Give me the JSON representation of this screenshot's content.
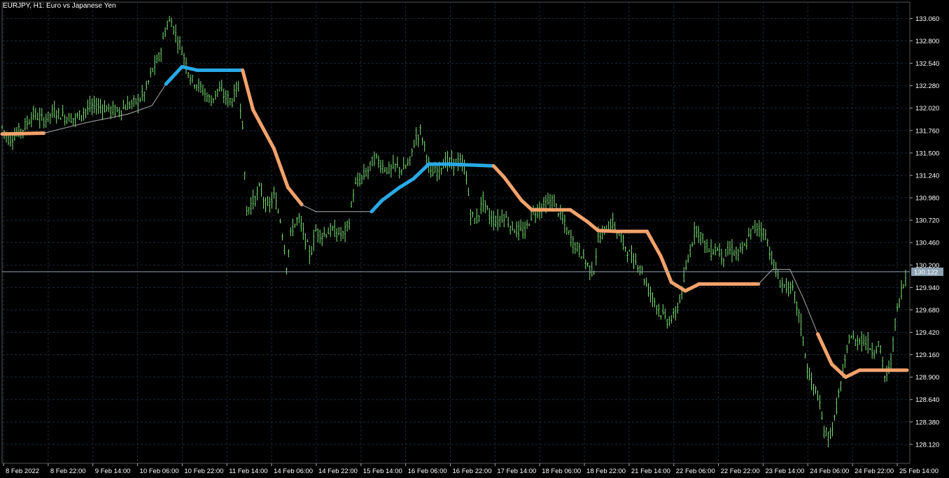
{
  "window": {
    "title": "EURJPY, H1:  Euro vs Japanese Yen"
  },
  "price_label": "130.122",
  "colors": {
    "background": "#000000",
    "grid": "#1a2a3a",
    "candle": "#7fe57a",
    "bull_line": "#29a9e6",
    "bear_line": "#f4a26b",
    "neutral_line": "#8f8f8f",
    "price_line": "#8da2b3",
    "axis": "#ffffff"
  },
  "chart_data": {
    "type": "line",
    "title": "EURJPY, H1:  Euro vs Japanese Yen",
    "xlabel": "",
    "ylabel": "",
    "ylim": [
      127.9,
      133.25
    ],
    "x_ticks": [
      "8 Feb 2022",
      "8 Feb 22:00",
      "9 Feb 14:00",
      "10 Feb 06:00",
      "10 Feb 22:00",
      "11 Feb 14:00",
      "14 Feb 06:00",
      "14 Feb 22:00",
      "15 Feb 14:00",
      "16 Feb 06:00",
      "16 Feb 22:00",
      "17 Feb 14:00",
      "18 Feb 06:00",
      "18 Feb 22:00",
      "21 Feb 14:00",
      "22 Feb 06:00",
      "22 Feb 22:00",
      "23 Feb 14:00",
      "24 Feb 06:00",
      "24 Feb 22:00",
      "25 Feb 14:00"
    ],
    "y_ticks": [
      "133.060",
      "132.800",
      "132.540",
      "132.280",
      "132.020",
      "131.760",
      "131.500",
      "131.240",
      "130.980",
      "130.720",
      "130.460",
      "130.200",
      "129.940",
      "129.680",
      "129.420",
      "129.160",
      "128.900",
      "128.640",
      "128.380",
      "128.120"
    ],
    "current_price": 130.122,
    "grid": true,
    "series": [
      {
        "kind": "candles",
        "points": [
          [
            0,
            131.8
          ],
          [
            10,
            131.65
          ],
          [
            20,
            131.72
          ],
          [
            30,
            131.78
          ],
          [
            45,
            131.95
          ],
          [
            60,
            131.88
          ],
          [
            75,
            131.98
          ],
          [
            90,
            131.92
          ],
          [
            105,
            131.9
          ],
          [
            120,
            132.0
          ],
          [
            135,
            132.05
          ],
          [
            150,
            132.02
          ],
          [
            165,
            131.98
          ],
          [
            180,
            132.05
          ],
          [
            195,
            132.1
          ],
          [
            205,
            132.2
          ],
          [
            215,
            132.45
          ],
          [
            225,
            132.6
          ],
          [
            235,
            132.95
          ],
          [
            242,
            133.05
          ],
          [
            250,
            132.85
          ],
          [
            258,
            132.7
          ],
          [
            265,
            132.5
          ],
          [
            272,
            132.35
          ],
          [
            280,
            132.3
          ],
          [
            290,
            132.2
          ],
          [
            300,
            132.1
          ],
          [
            310,
            132.25
          ],
          [
            320,
            132.15
          ],
          [
            330,
            132.1
          ],
          [
            338,
            132.3
          ],
          [
            345,
            131.85
          ],
          [
            350,
            130.8
          ],
          [
            356,
            130.9
          ],
          [
            362,
            130.95
          ],
          [
            370,
            131.1
          ],
          [
            380,
            130.85
          ],
          [
            390,
            131.0
          ],
          [
            400,
            130.7
          ],
          [
            408,
            130.2
          ],
          [
            415,
            130.6
          ],
          [
            425,
            130.75
          ],
          [
            435,
            130.5
          ],
          [
            442,
            130.3
          ],
          [
            450,
            130.6
          ],
          [
            460,
            130.55
          ],
          [
            470,
            130.6
          ],
          [
            480,
            130.58
          ],
          [
            490,
            130.55
          ],
          [
            498,
            130.7
          ],
          [
            505,
            131.1
          ],
          [
            515,
            131.2
          ],
          [
            525,
            131.3
          ],
          [
            535,
            131.45
          ],
          [
            545,
            131.35
          ],
          [
            555,
            131.3
          ],
          [
            565,
            131.35
          ],
          [
            575,
            131.3
          ],
          [
            585,
            131.4
          ],
          [
            592,
            131.65
          ],
          [
            600,
            131.75
          ],
          [
            607,
            131.55
          ],
          [
            615,
            131.25
          ],
          [
            625,
            131.3
          ],
          [
            635,
            131.4
          ],
          [
            645,
            131.38
          ],
          [
            655,
            131.4
          ],
          [
            665,
            131.3
          ],
          [
            672,
            130.8
          ],
          [
            680,
            130.7
          ],
          [
            690,
            130.95
          ],
          [
            700,
            130.75
          ],
          [
            710,
            130.7
          ],
          [
            720,
            130.78
          ],
          [
            730,
            130.65
          ],
          [
            740,
            130.6
          ],
          [
            750,
            130.58
          ],
          [
            760,
            130.8
          ],
          [
            770,
            130.85
          ],
          [
            780,
            130.9
          ],
          [
            790,
            130.95
          ],
          [
            800,
            130.8
          ],
          [
            810,
            130.6
          ],
          [
            820,
            130.45
          ],
          [
            830,
            130.35
          ],
          [
            840,
            130.2
          ],
          [
            848,
            130.1
          ],
          [
            855,
            130.5
          ],
          [
            865,
            130.6
          ],
          [
            875,
            130.7
          ],
          [
            885,
            130.55
          ],
          [
            895,
            130.4
          ],
          [
            905,
            130.25
          ],
          [
            915,
            130.2
          ],
          [
            925,
            129.95
          ],
          [
            935,
            129.8
          ],
          [
            945,
            129.65
          ],
          [
            955,
            129.55
          ],
          [
            965,
            129.6
          ],
          [
            975,
            129.9
          ],
          [
            985,
            130.3
          ],
          [
            995,
            130.65
          ],
          [
            1005,
            130.5
          ],
          [
            1015,
            130.35
          ],
          [
            1025,
            130.4
          ],
          [
            1035,
            130.3
          ],
          [
            1045,
            130.38
          ],
          [
            1055,
            130.32
          ],
          [
            1065,
            130.4
          ],
          [
            1075,
            130.6
          ],
          [
            1085,
            130.65
          ],
          [
            1095,
            130.55
          ],
          [
            1105,
            130.25
          ],
          [
            1115,
            130.0
          ],
          [
            1125,
            129.95
          ],
          [
            1135,
            129.9
          ],
          [
            1145,
            129.55
          ],
          [
            1155,
            129.0
          ],
          [
            1162,
            128.8
          ],
          [
            1170,
            128.7
          ],
          [
            1178,
            128.3
          ],
          [
            1186,
            128.2
          ],
          [
            1194,
            128.4
          ],
          [
            1200,
            128.7
          ],
          [
            1208,
            129.0
          ],
          [
            1216,
            129.4
          ],
          [
            1224,
            129.3
          ],
          [
            1232,
            129.35
          ],
          [
            1240,
            129.3
          ],
          [
            1250,
            129.2
          ],
          [
            1258,
            129.3
          ],
          [
            1266,
            128.9
          ],
          [
            1274,
            129.0
          ],
          [
            1282,
            129.6
          ],
          [
            1290,
            129.9
          ],
          [
            1298,
            130.1
          ]
        ]
      },
      {
        "kind": "ribbon",
        "points": [
          [
            0,
            131.72,
            "bear"
          ],
          [
            60,
            131.73,
            "bear"
          ],
          [
            120,
            131.85,
            "neutral"
          ],
          [
            180,
            131.95,
            "neutral"
          ],
          [
            215,
            132.05,
            "neutral"
          ],
          [
            235,
            132.3,
            "neutral"
          ],
          [
            258,
            132.5,
            "bull"
          ],
          [
            280,
            132.46,
            "bull"
          ],
          [
            345,
            132.46,
            "bull"
          ],
          [
            360,
            132.0,
            "bear"
          ],
          [
            390,
            131.55,
            "bear"
          ],
          [
            410,
            131.1,
            "bear"
          ],
          [
            430,
            130.9,
            "bear"
          ],
          [
            450,
            130.82,
            "neutral"
          ],
          [
            530,
            130.82,
            "neutral"
          ],
          [
            545,
            130.95,
            "bull"
          ],
          [
            570,
            131.1,
            "bull"
          ],
          [
            590,
            131.2,
            "bull"
          ],
          [
            612,
            131.37,
            "bull"
          ],
          [
            640,
            131.37,
            "bull"
          ],
          [
            705,
            131.35,
            "bull"
          ],
          [
            720,
            131.22,
            "bear"
          ],
          [
            745,
            130.95,
            "bear"
          ],
          [
            760,
            130.84,
            "bear"
          ],
          [
            815,
            130.84,
            "bear"
          ],
          [
            840,
            130.7,
            "bear"
          ],
          [
            855,
            130.6,
            "bear"
          ],
          [
            880,
            130.59,
            "bear"
          ],
          [
            925,
            130.59,
            "bear"
          ],
          [
            945,
            130.3,
            "bear"
          ],
          [
            960,
            130.0,
            "bear"
          ],
          [
            980,
            129.9,
            "bear"
          ],
          [
            1000,
            129.98,
            "bear"
          ],
          [
            1085,
            129.98,
            "bear"
          ],
          [
            1105,
            130.15,
            "neutral"
          ],
          [
            1130,
            130.15,
            "neutral"
          ],
          [
            1150,
            129.8,
            "neutral"
          ],
          [
            1170,
            129.4,
            "neutral"
          ],
          [
            1190,
            129.05,
            "bear"
          ],
          [
            1210,
            128.9,
            "bear"
          ],
          [
            1230,
            128.98,
            "bear"
          ],
          [
            1298,
            128.98,
            "bear"
          ]
        ]
      }
    ]
  }
}
